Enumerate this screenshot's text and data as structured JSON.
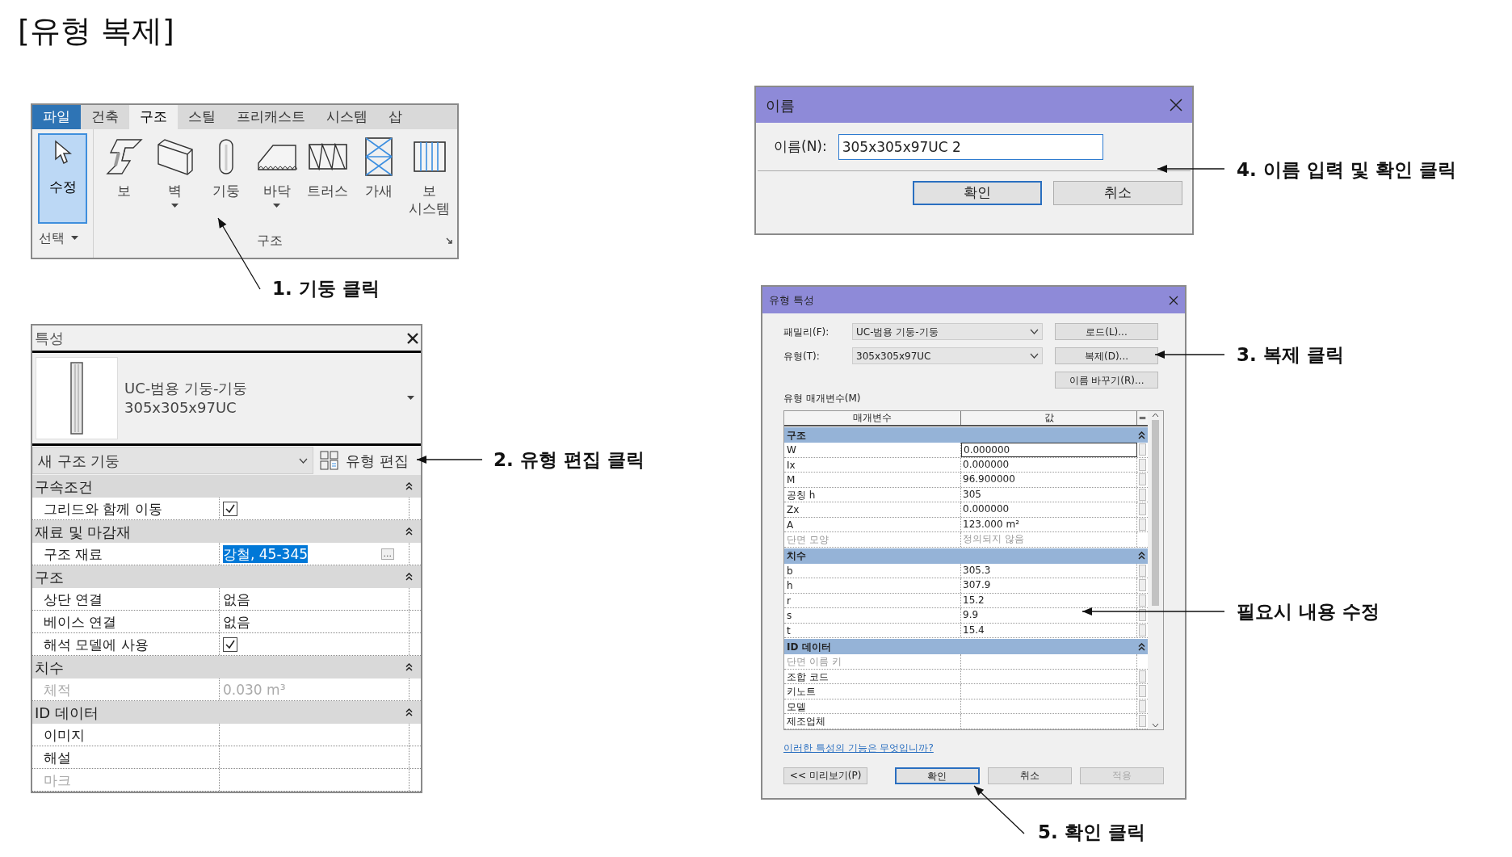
{
  "title": "[유형 복제]",
  "ribbon": {
    "tabs": [
      {
        "label": "파일",
        "kind": "file",
        "selected": false
      },
      {
        "label": "건축",
        "kind": "tab",
        "selected": false
      },
      {
        "label": "구조",
        "kind": "tab",
        "selected": true
      },
      {
        "label": "스틸",
        "kind": "tab",
        "selected": false
      },
      {
        "label": "프리캐스트",
        "kind": "tab",
        "selected": false
      },
      {
        "label": "시스템",
        "kind": "tab",
        "selected": false
      },
      {
        "label": "삽",
        "kind": "tab",
        "selected": false
      }
    ],
    "select_panel": {
      "tool": {
        "label": "수정",
        "kind": "modify",
        "selected": true
      },
      "label": "선택"
    },
    "structure_panel": {
      "tools": [
        {
          "label": "보",
          "kind": "beam",
          "selected": false,
          "dropdown": false
        },
        {
          "label": "벽",
          "kind": "wall",
          "selected": false,
          "dropdown": true
        },
        {
          "label": "기둥",
          "kind": "column",
          "selected": false,
          "dropdown": false
        },
        {
          "label": "바닥",
          "kind": "floor",
          "selected": false,
          "dropdown": true
        },
        {
          "label": "트러스",
          "kind": "truss",
          "selected": false,
          "dropdown": false
        },
        {
          "label": "가새",
          "kind": "brace",
          "selected": false,
          "dropdown": false
        },
        {
          "label": "보 시스템",
          "kind": "beam_system",
          "selected": false,
          "dropdown": false
        }
      ],
      "label": "구조"
    }
  },
  "properties": {
    "title": "특성",
    "family": "UC-범용 기둥-기둥",
    "type": "305x305x97UC",
    "instance_selector": "새 구조 기둥",
    "edit_type_button": "유형 편집",
    "groups": [
      {
        "name": "구속조건",
        "rows": [
          {
            "label": "그리드와 함께 이동",
            "kind": "check",
            "checked": true,
            "selected": false,
            "disabled": false
          }
        ]
      },
      {
        "name": "재료 및 마감재",
        "rows": [
          {
            "label": "구조 재료",
            "kind": "text",
            "value": "강철, 45-345",
            "selected": true,
            "browse_button": "...",
            "disabled": false
          }
        ]
      },
      {
        "name": "구조",
        "rows": [
          {
            "label": "상단 연결",
            "kind": "text",
            "value": "없음",
            "selected": false,
            "disabled": false
          },
          {
            "label": "베이스 연결",
            "kind": "text",
            "value": "없음",
            "selected": false,
            "disabled": false
          },
          {
            "label": "해석 모델에 사용",
            "kind": "check",
            "checked": true,
            "selected": false,
            "disabled": false
          }
        ]
      },
      {
        "name": "치수",
        "rows": [
          {
            "label": "체적",
            "kind": "text",
            "value": "0.030 m³",
            "selected": false,
            "disabled": true
          }
        ]
      },
      {
        "name": "ID 데이터",
        "rows": [
          {
            "label": "이미지",
            "kind": "text",
            "selected": false,
            "disabled": false
          },
          {
            "label": "해설",
            "kind": "text",
            "selected": false,
            "disabled": false
          },
          {
            "label": "마크",
            "kind": "text",
            "selected": false,
            "disabled": true
          }
        ]
      }
    ]
  },
  "name_dialog": {
    "title": "이름",
    "label": "이름(N):",
    "value": "305x305x97UC 2",
    "buttons": [
      {
        "label": "확인",
        "default": true
      },
      {
        "label": "취소",
        "default": false
      }
    ]
  },
  "type_dialog": {
    "title": "유형 특성",
    "fields": [
      {
        "label": "패밀리(F):",
        "value": "UC-범용 기둥-기둥"
      },
      {
        "label": "유형(T):",
        "value": "305x305x97UC"
      }
    ],
    "side_buttons": [
      "로드(L)...",
      "복제(D)...",
      "이름 바꾸기(R)..."
    ],
    "params_label": "유형 매개변수(M)",
    "columns": [
      "매개변수",
      "값",
      "="
    ],
    "groups": [
      {
        "name": "구조",
        "rows": [
          {
            "label": "W",
            "value": "0.000000",
            "focused": true,
            "disabled": false
          },
          {
            "label": "Ix",
            "value": "0.000000",
            "focused": false,
            "disabled": false
          },
          {
            "label": "M",
            "value": "96.900000",
            "focused": false,
            "disabled": false
          },
          {
            "label": "공칭 h",
            "value": "305",
            "focused": false,
            "disabled": false
          },
          {
            "label": "Zx",
            "value": "0.000000",
            "focused": false,
            "disabled": false
          },
          {
            "label": "A",
            "value": "123.000 m²",
            "focused": false,
            "disabled": false
          },
          {
            "label": "단면 모양",
            "value": "정의되지 않음",
            "focused": false,
            "disabled": true
          }
        ]
      },
      {
        "name": "치수",
        "rows": [
          {
            "label": "b",
            "value": "305.3",
            "focused": false,
            "disabled": false
          },
          {
            "label": "h",
            "value": "307.9",
            "focused": false,
            "disabled": false
          },
          {
            "label": "r",
            "value": "15.2",
            "focused": false,
            "disabled": false
          },
          {
            "label": "s",
            "value": "9.9",
            "focused": false,
            "disabled": false
          },
          {
            "label": "t",
            "value": "15.4",
            "focused": false,
            "disabled": false
          }
        ]
      },
      {
        "name": "ID 데이터",
        "rows": [
          {
            "label": "단면 이름 키",
            "focused": false,
            "disabled": true
          },
          {
            "label": "조합 코드",
            "focused": false,
            "disabled": false
          },
          {
            "label": "키노트",
            "focused": false,
            "disabled": false
          },
          {
            "label": "모델",
            "focused": false,
            "disabled": false
          },
          {
            "label": "제조업체",
            "focused": false,
            "disabled": false
          }
        ]
      }
    ],
    "help_link": "이러한 특성의 기능은 무엇입니까?",
    "buttons": [
      {
        "label": "<< 미리보기(P)",
        "default": false,
        "disabled": false
      },
      {
        "label": "확인",
        "default": true,
        "disabled": false
      },
      {
        "label": "취소",
        "default": false,
        "disabled": false
      },
      {
        "label": "적용",
        "default": false,
        "disabled": true
      }
    ]
  },
  "annotations": [
    {
      "text": "1. 기둥 클릭"
    },
    {
      "text": "2. 유형 편집 클릭"
    },
    {
      "text": "4. 이름 입력 및 확인 클릭"
    },
    {
      "text": "3. 복제 클릭"
    },
    {
      "text": "필요시 내용 수정"
    },
    {
      "text": "5. 확인 클릭"
    }
  ]
}
